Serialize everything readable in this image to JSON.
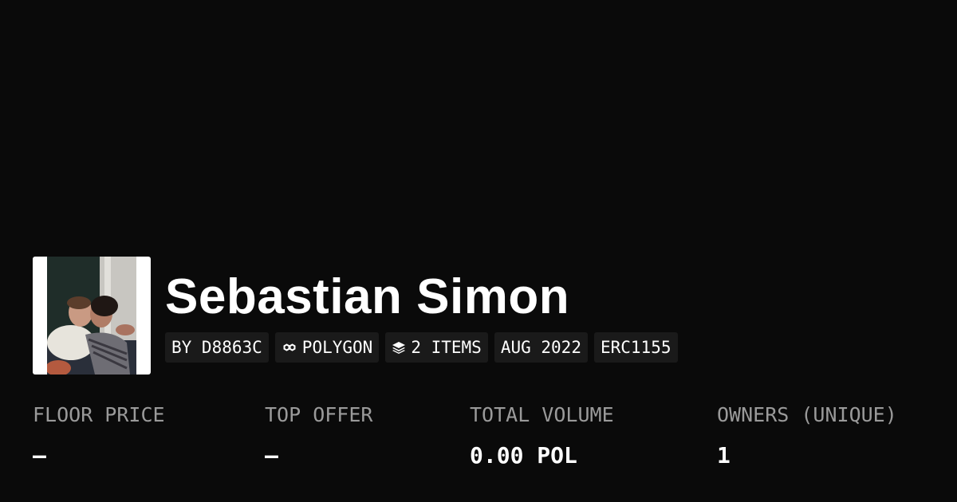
{
  "collection": {
    "title": "Sebastian Simon",
    "tags": [
      {
        "text": "BY D8863C",
        "icon": ""
      },
      {
        "text": "POLYGON",
        "icon": "polygon-icon"
      },
      {
        "text": "2 ITEMS",
        "icon": "layers-icon"
      },
      {
        "text": "AUG 2022",
        "icon": ""
      },
      {
        "text": "ERC1155",
        "icon": ""
      }
    ]
  },
  "stats": [
    {
      "label": "FLOOR PRICE",
      "value": "–"
    },
    {
      "label": "TOP OFFER",
      "value": "–"
    },
    {
      "label": "TOTAL VOLUME",
      "value": "0.00 POL"
    },
    {
      "label": "OWNERS (UNIQUE)",
      "value": "1"
    }
  ],
  "colors": {
    "background": "#0a0a0a",
    "tag_background": "#1a1a1a",
    "label_gray": "#9a9a9a",
    "text": "#ffffff"
  }
}
